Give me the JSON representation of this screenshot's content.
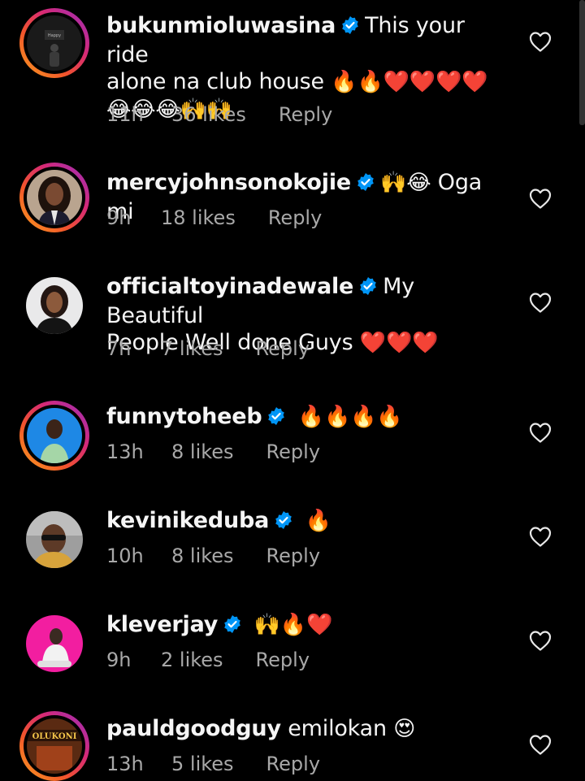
{
  "accent": {
    "verified_blue": "#0095f6",
    "meta_gray": "#a8a8a8",
    "background": "#000000"
  },
  "comments": [
    {
      "username": "bukunmioluwasina",
      "verified": true,
      "text_line1": "This your ride",
      "text_line2": "alone na club house",
      "emoji_line2": "🔥🔥❤️❤️❤️❤️",
      "emoji_line3": "😂😂😂🙌🙌",
      "time": "11h",
      "likes": "36 likes",
      "reply": "Reply",
      "avatar_icon": "person-silhouette-icon"
    },
    {
      "username": "mercyjohnsonokojie",
      "verified": true,
      "emoji": "🙌😂",
      "text": "Oga mi",
      "time": "9h",
      "likes": "18 likes",
      "reply": "Reply",
      "avatar_icon": "woman-portrait-icon"
    },
    {
      "username": "officialtoyinadewale",
      "verified": true,
      "text_line1": "My Beautiful",
      "text_line2": "People Well done Guys",
      "emoji_line2": "❤️❤️❤️",
      "time": "7h",
      "likes": "7 likes",
      "reply": "Reply",
      "avatar_icon": "woman-portrait-icon"
    },
    {
      "username": "funnytoheeb",
      "verified": true,
      "emoji": "🔥🔥🔥🔥",
      "time": "13h",
      "likes": "8 likes",
      "reply": "Reply",
      "avatar_icon": "man-portrait-icon"
    },
    {
      "username": "kevinikeduba",
      "verified": true,
      "emoji": "🔥",
      "time": "10h",
      "likes": "8 likes",
      "reply": "Reply",
      "avatar_icon": "man-sunglasses-icon"
    },
    {
      "username": "kleverjay",
      "verified": true,
      "emoji": "🙌🔥❤️",
      "time": "9h",
      "likes": "2 likes",
      "reply": "Reply",
      "avatar_icon": "man-portrait-icon"
    },
    {
      "username": "pauldgoodguy",
      "verified": false,
      "text": "emilokan",
      "emoji": "😍",
      "time": "13h",
      "likes": "5 likes",
      "reply": "Reply",
      "avatar_logo_text": "OLUKONI",
      "avatar_icon": "poster-icon"
    }
  ]
}
